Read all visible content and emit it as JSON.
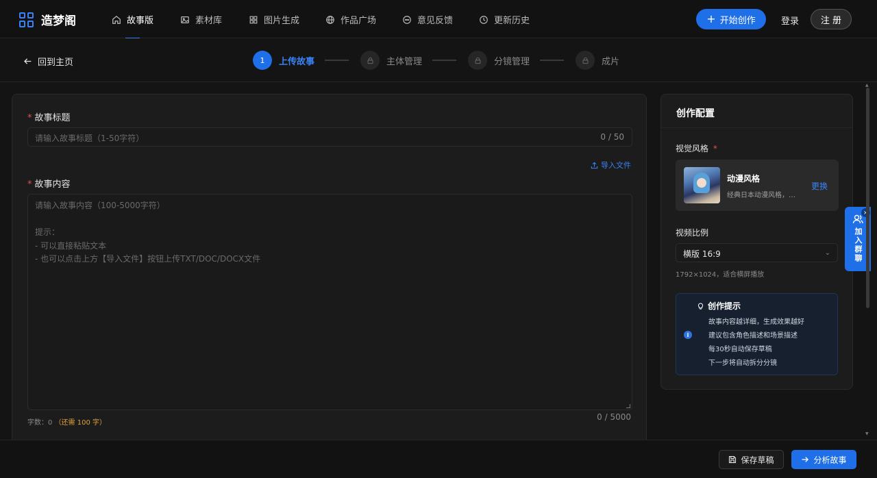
{
  "nav": {
    "logo_text": "造梦阁",
    "items": [
      {
        "label": "故事版",
        "icon": "home-icon",
        "active": true
      },
      {
        "label": "素材库",
        "icon": "image-icon"
      },
      {
        "label": "图片生成",
        "icon": "grid-icon"
      },
      {
        "label": "作品广场",
        "icon": "globe-icon"
      },
      {
        "label": "意见反馈",
        "icon": "chat-icon"
      },
      {
        "label": "更新历史",
        "icon": "history-icon"
      }
    ],
    "start_button": "开始创作",
    "login": "登录",
    "register": "注 册"
  },
  "stepbar": {
    "back_label": "回到主页",
    "steps": [
      {
        "number": "1",
        "label": "上传故事",
        "active": true
      },
      {
        "label": "主体管理",
        "icon": "lock-icon"
      },
      {
        "label": "分镜管理",
        "icon": "lock-icon"
      },
      {
        "label": "成片",
        "icon": "lock-icon"
      }
    ]
  },
  "form": {
    "title_label": "故事标题",
    "title_placeholder": "请输入故事标题（1-50字符）",
    "title_count": "0 / 50",
    "import_label": "导入文件",
    "content_label": "故事内容",
    "content_placeholder_lines": [
      "请输入故事内容（100-5000字符）",
      "",
      "提示：",
      "- 可以直接粘贴文本",
      "- 也可以点击上方【导入文件】按钮上传TXT/DOC/DOCX文件"
    ],
    "word_count_prefix": "字数：0",
    "word_count_need": "（还需 100 字）",
    "content_count": "0 / 5000"
  },
  "config": {
    "title": "创作配置",
    "style_label": "视觉风格",
    "style_name": "动漫风格",
    "style_desc": "经典日本动漫风格，色彩鲜艳",
    "style_change": "更换",
    "ratio_label": "视频比例",
    "ratio_value": "横版 16:9",
    "ratio_hint": "1792×1024，适合横屏播放",
    "tips_title": "创作提示",
    "tips": [
      "故事内容越详细，生成效果越好",
      "建议包含角色描述和场景描述",
      "每30秒自动保存草稿",
      "下一步将自动拆分分镜"
    ]
  },
  "float": {
    "join_label": "加入群聊",
    "close": "×"
  },
  "footer": {
    "save_label": "保存草稿",
    "analyze_label": "分析故事"
  },
  "colors": {
    "accent": "#1f6fe8",
    "required": "#e05353",
    "warning": "#e0a13b"
  }
}
